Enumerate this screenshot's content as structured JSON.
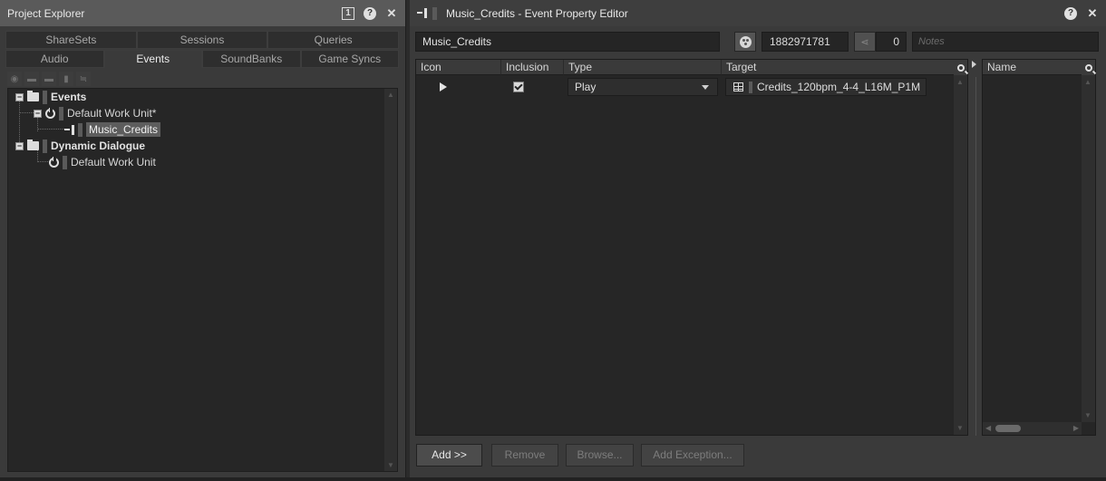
{
  "project_explorer": {
    "title": "Project Explorer",
    "header_icons": {
      "number_badge": "1",
      "help": "?",
      "close": "✕"
    },
    "tabs_row1": [
      "ShareSets",
      "Sessions",
      "Queries"
    ],
    "tabs_row2": [
      "Audio",
      "Events",
      "SoundBanks",
      "Game Syncs"
    ],
    "active_tab": "Events",
    "toolbar_icons": [
      "work-unit-icon",
      "folder-icon",
      "virtual-folder-icon",
      "event-icon",
      "dialogue-event-icon"
    ],
    "tree": {
      "events_folder": "Events",
      "default_work_unit_modified": "Default Work Unit*",
      "music_credits": "Music_Credits",
      "dynamic_dialogue_folder": "Dynamic Dialogue",
      "default_work_unit": "Default Work Unit"
    }
  },
  "event_editor": {
    "title": "Music_Credits - Event Property Editor",
    "header_icons": {
      "help": "?",
      "close": "✕"
    },
    "name": "Music_Credits",
    "short_id": "1882971781",
    "reference_count": "0",
    "notes_placeholder": "Notes",
    "columns": [
      "Icon",
      "Inclusion",
      "Type",
      "Target"
    ],
    "actions": [
      {
        "icon": "play-icon",
        "inclusion": true,
        "type": "Play",
        "target": "Credits_120bpm_4-4_L16M_P1M"
      }
    ],
    "exceptions_column": "Name",
    "buttons": {
      "add": "Add >>",
      "remove": "Remove",
      "browse": "Browse...",
      "add_exception": "Add Exception..."
    }
  },
  "colors": {
    "panel_bg": "#3a3a3a",
    "field_bg": "#252525",
    "title_bar": "#5a5a5a",
    "selection": "#5d5d5d"
  }
}
